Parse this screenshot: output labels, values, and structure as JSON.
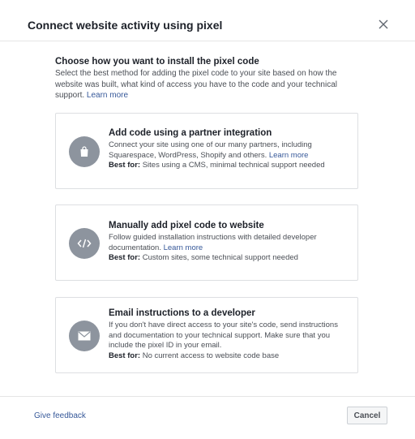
{
  "dialog": {
    "title": "Connect website activity using pixel",
    "close_icon": "close-icon"
  },
  "intro": {
    "heading": "Choose how you want to install the pixel code",
    "text": "Select the best method for adding the pixel code to your site based on how the website was built, what kind of access you have to the code and your technical support.",
    "learn_more": "Learn more"
  },
  "options": [
    {
      "icon": "shopping-bag-icon",
      "title": "Add code using a partner integration",
      "text": "Connect your site using one of our many partners, including Squarespace, WordPress, Shopify and others.",
      "learn_more": "Learn more",
      "best_for_label": "Best for:",
      "best_for": "Sites using a CMS, minimal technical support needed"
    },
    {
      "icon": "code-icon",
      "title": "Manually add pixel code to website",
      "text": "Follow guided installation instructions with detailed developer documentation.",
      "learn_more": "Learn more",
      "best_for_label": "Best for:",
      "best_for": "Custom sites, some technical support needed"
    },
    {
      "icon": "envelope-icon",
      "title": "Email instructions to a developer",
      "text": "If you don't have direct access to your site's code, send instructions and documentation to your technical support. Make sure that you include the pixel ID in your email.",
      "best_for_label": "Best for:",
      "best_for": "No current access to website code base"
    }
  ],
  "footer": {
    "feedback": "Give feedback",
    "cancel": "Cancel"
  },
  "colors": {
    "link": "#365899",
    "icon_circle": "#8d949e",
    "border": "#dddfe2"
  }
}
